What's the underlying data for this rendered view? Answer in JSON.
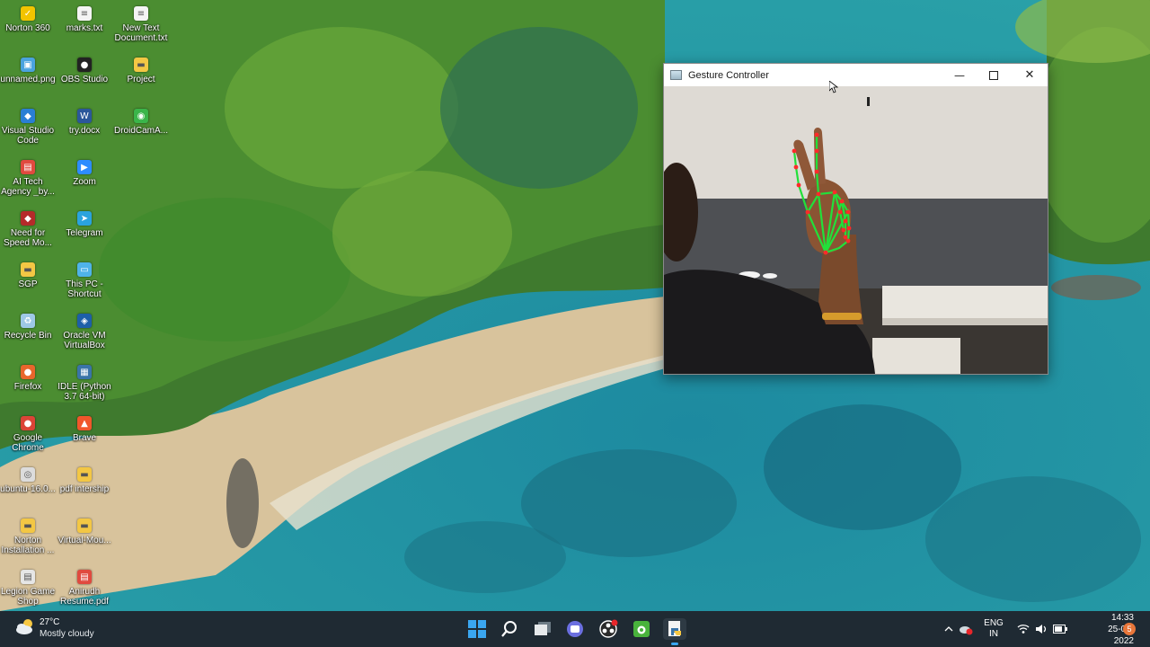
{
  "desktop": {
    "icons": [
      {
        "label": "Norton 360",
        "icon": "norton-icon",
        "color": "#f2c400"
      },
      {
        "label": "marks.txt",
        "icon": "text-file-icon",
        "color": "#f4f4f4"
      },
      {
        "label": "New Text\nDocument.txt",
        "icon": "text-file-icon",
        "color": "#f4f4f4"
      },
      {
        "label": "unnamed.png",
        "icon": "image-file-icon",
        "color": "#4aa3df"
      },
      {
        "label": "OBS Studio",
        "icon": "obs-icon",
        "color": "#222222"
      },
      {
        "label": "Project",
        "icon": "folder-icon",
        "color": "#f3c744"
      },
      {
        "label": "Visual Studio\nCode",
        "icon": "vscode-icon",
        "color": "#2a7fd4"
      },
      {
        "label": "try.docx",
        "icon": "word-doc-icon",
        "color": "#2b579a"
      },
      {
        "label": "DroidCamA...",
        "icon": "droidcam-icon",
        "color": "#3bb54a"
      },
      {
        "label": "AI Tech\nAgency _by...",
        "icon": "pdf-file-icon",
        "color": "#e04a3f"
      },
      {
        "label": "Zoom",
        "icon": "zoom-icon",
        "color": "#2d8cff"
      },
      {
        "label": "Need for\nSpeed Mo...",
        "icon": "game-icon",
        "color": "#b52a2a"
      },
      {
        "label": "Telegram",
        "icon": "telegram-icon",
        "color": "#2aa3de"
      },
      {
        "label": "SGP",
        "icon": "folder-icon",
        "color": "#f3c744"
      },
      {
        "label": "This PC -\nShortcut",
        "icon": "this-pc-icon",
        "color": "#4fb3e8"
      },
      {
        "label": "Recycle Bin",
        "icon": "recycle-bin-icon",
        "color": "#9ec8e6"
      },
      {
        "label": "Oracle VM\nVirtualBox",
        "icon": "virtualbox-icon",
        "color": "#1d5fa8"
      },
      {
        "label": "Firefox",
        "icon": "firefox-icon",
        "color": "#e8662c"
      },
      {
        "label": "IDLE (Python\n3.7 64-bit)",
        "icon": "python-idle-icon",
        "color": "#3a74a8"
      },
      {
        "label": "Google\nChrome",
        "icon": "chrome-icon",
        "color": "#db4437"
      },
      {
        "label": "Brave",
        "icon": "brave-icon",
        "color": "#f1562b"
      },
      {
        "label": "ubuntu-16.0...",
        "icon": "disc-image-icon",
        "color": "#dcdcdc"
      },
      {
        "label": "pdf intership",
        "icon": "folder-icon",
        "color": "#f3c744"
      },
      {
        "label": "Norton\nInstallation ...",
        "icon": "folder-icon",
        "color": "#f3c744"
      },
      {
        "label": "Virtual-Mou...",
        "icon": "folder-icon",
        "color": "#f3c744"
      },
      {
        "label": "Legion Game\nShop",
        "icon": "shortcut-icon",
        "color": "#e6e6e6"
      },
      {
        "label": "Anirudh\nResume.pdf",
        "icon": "pdf-file-icon",
        "color": "#e04a3f"
      }
    ]
  },
  "window": {
    "title": "Gesture Controller",
    "minimize_glyph": "—",
    "close_glyph": "✕"
  },
  "taskbar": {
    "weather": {
      "temp": "27°C",
      "desc": "Mostly cloudy"
    },
    "apps": [
      {
        "name": "start-button",
        "icon": "windows-logo-icon"
      },
      {
        "name": "search-button",
        "icon": "search-icon"
      },
      {
        "name": "task-view-button",
        "icon": "task-view-icon"
      },
      {
        "name": "teams-chat-button",
        "icon": "chat-icon"
      },
      {
        "name": "obs-taskbar-button",
        "icon": "obs-icon"
      },
      {
        "name": "droidcam-taskbar-button",
        "icon": "droidcam-icon"
      },
      {
        "name": "python-taskbar-button",
        "icon": "python-idle-icon"
      }
    ],
    "lang": {
      "line1": "ENG",
      "line2": "IN"
    },
    "clock": {
      "time": "14:33",
      "date": "25-07-2022"
    },
    "notification_count": "5"
  },
  "colors": {
    "taskbar": "#1f2a33",
    "landmark_green": "#22e03a",
    "landmark_red": "#ff2a2a"
  }
}
